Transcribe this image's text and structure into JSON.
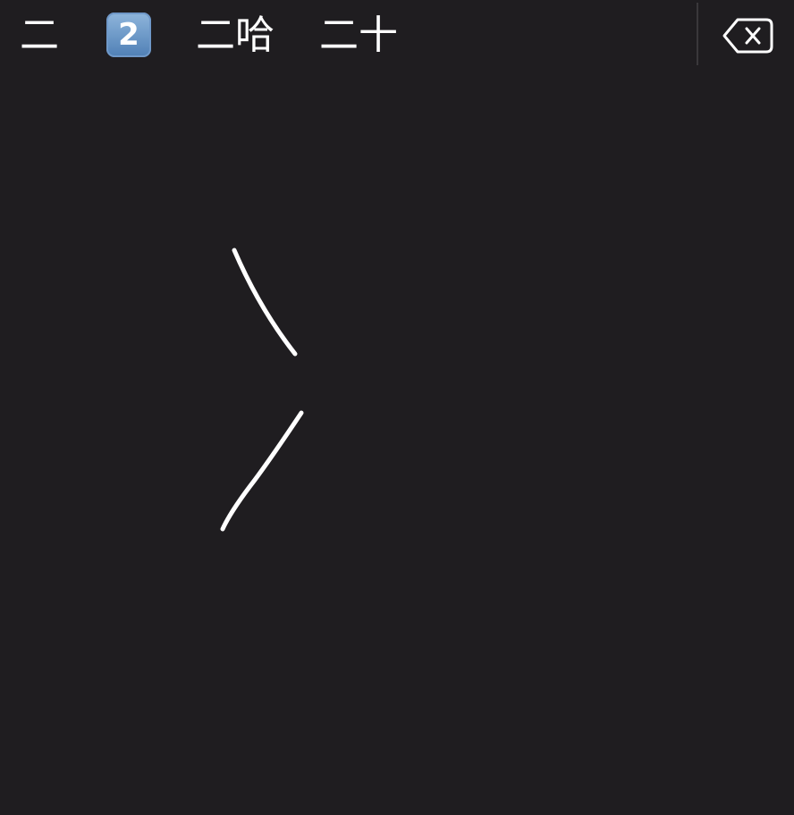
{
  "candidates": [
    {
      "label": "二"
    },
    {
      "label": "2"
    },
    {
      "label": "二哈"
    },
    {
      "label": "二十"
    }
  ],
  "icons": {
    "delete": "backspace-icon"
  },
  "colors": {
    "background": "#1f1d20",
    "text": "#ffffff",
    "stroke": "#ffffff",
    "keycap": "#5f8fc6"
  }
}
